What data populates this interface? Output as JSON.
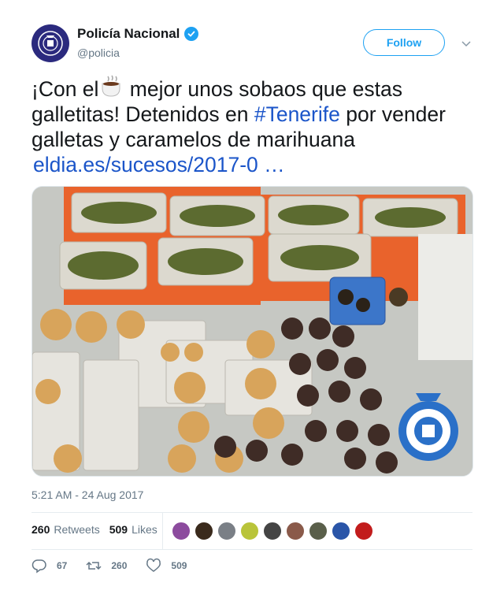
{
  "user": {
    "name": "Policía Nacional",
    "handle": "@policia"
  },
  "follow_label": "Follow",
  "tweet": {
    "text_before_emoji": "¡Con el",
    "text_after_emoji": " mejor unos sobaos que estas galletitas! Detenidos en ",
    "hashtag": "#Tenerife",
    "text_after_hashtag": " por vender galletas y caramelos de marihuana",
    "link": "eldia.es/sucesos/2017-0",
    "link_ellipsis": "…"
  },
  "timestamp": "5:21 AM - 24 Aug 2017",
  "stats": {
    "retweets_count": "260",
    "retweets_label": "Retweets",
    "likes_count": "509",
    "likes_label": "Likes"
  },
  "likers": [
    {
      "color": "#8c4b9e"
    },
    {
      "color": "#3a2a1c"
    },
    {
      "color": "#7a7f86"
    },
    {
      "color": "#b9c43a"
    },
    {
      "color": "#444444"
    },
    {
      "color": "#8a5a4a"
    },
    {
      "color": "#5a5f4a"
    },
    {
      "color": "#2a55a8"
    },
    {
      "color": "#c21c1c"
    }
  ],
  "actions": {
    "replies": "67",
    "retweets": "260",
    "likes": "509"
  },
  "colors": {
    "accent": "#1da1f2",
    "link": "#1b55c9",
    "muted": "#657786"
  }
}
